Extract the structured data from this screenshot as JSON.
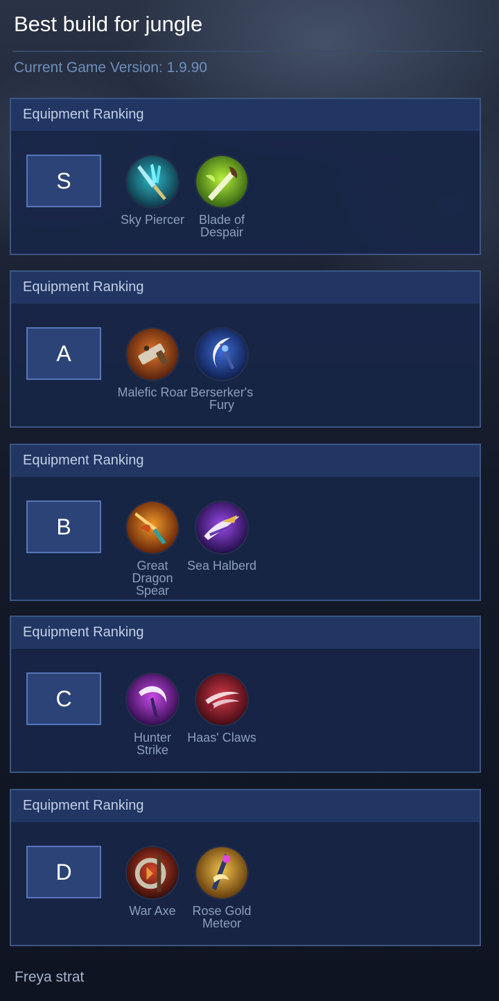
{
  "page": {
    "title": "Best build for jungle",
    "version_text": "Current Game Version: 1.9.90",
    "footer_text": "Freya strat"
  },
  "colors": {
    "panel_border": "#3b5684",
    "panel_header": "#213663",
    "tier_box": "#2c4378",
    "item_label": "#8d9ebd"
  },
  "rankings": [
    {
      "header": "Equipment Ranking",
      "tier": "S",
      "items": [
        {
          "name": "Sky Piercer",
          "icon": "sky-piercer-icon"
        },
        {
          "name": "Blade of Despair",
          "icon": "blade-of-despair-icon"
        }
      ]
    },
    {
      "header": "Equipment Ranking",
      "tier": "A",
      "items": [
        {
          "name": "Malefic Roar",
          "icon": "malefic-roar-icon"
        },
        {
          "name": "Berserker's Fury",
          "icon": "berserkers-fury-icon"
        }
      ]
    },
    {
      "header": "Equipment Ranking",
      "tier": "B",
      "items": [
        {
          "name": "Great Dragon Spear",
          "icon": "great-dragon-spear-icon"
        },
        {
          "name": "Sea Halberd",
          "icon": "sea-halberd-icon"
        }
      ]
    },
    {
      "header": "Equipment Ranking",
      "tier": "C",
      "items": [
        {
          "name": "Hunter Strike",
          "icon": "hunter-strike-icon"
        },
        {
          "name": "Haas' Claws",
          "icon": "haas-claws-icon"
        }
      ]
    },
    {
      "header": "Equipment Ranking",
      "tier": "D",
      "items": [
        {
          "name": "War Axe",
          "icon": "war-axe-icon"
        },
        {
          "name": "Rose Gold Meteor",
          "icon": "rose-gold-meteor-icon"
        }
      ]
    }
  ]
}
